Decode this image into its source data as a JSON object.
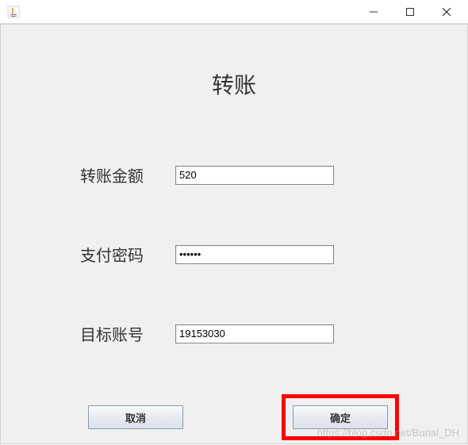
{
  "window": {
    "title": ""
  },
  "page": {
    "title": "转账"
  },
  "form": {
    "amount": {
      "label": "转账金额",
      "value": "520"
    },
    "password": {
      "label": "支付密码",
      "value": "••••••"
    },
    "target": {
      "label": "目标账号",
      "value": "19153030"
    }
  },
  "buttons": {
    "cancel": "取消",
    "confirm": "确定"
  },
  "watermark": "https://blog.csdn.net/Burial_DH"
}
